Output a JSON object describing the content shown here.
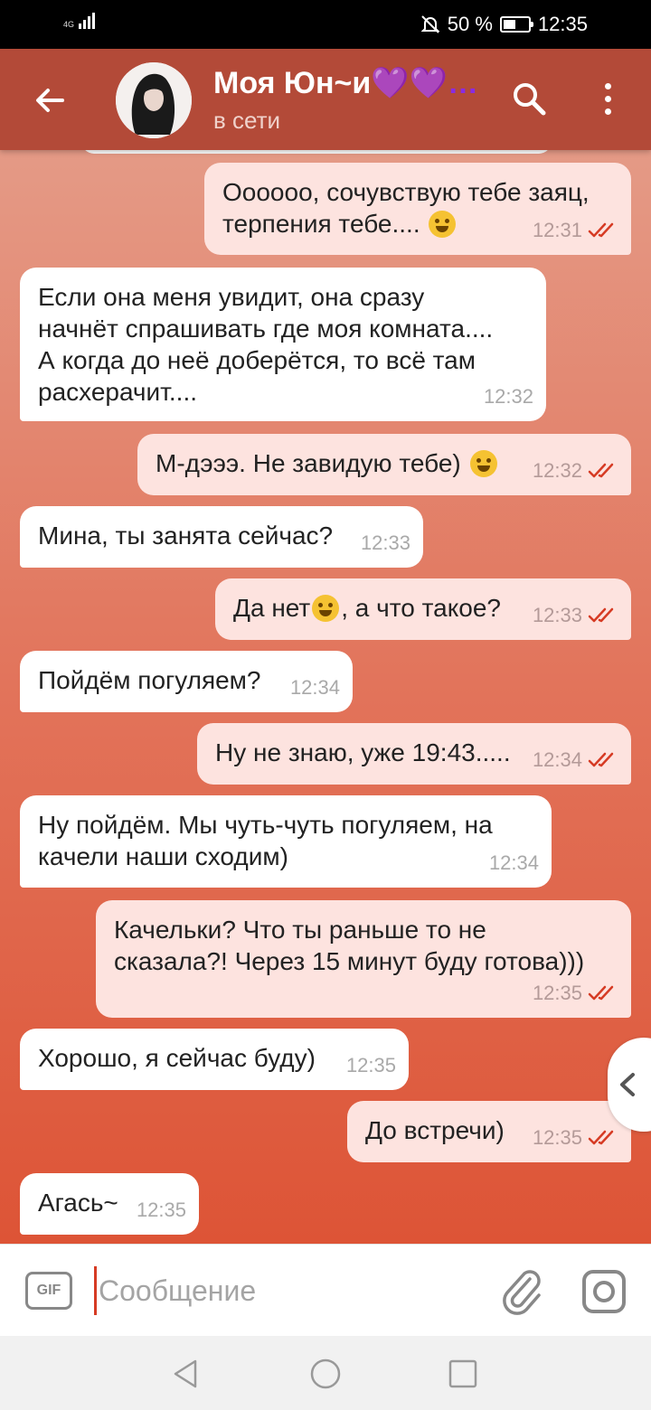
{
  "status_bar": {
    "network": "4G",
    "battery_text": "50 %",
    "battery_level": 0.5,
    "time": "12:35"
  },
  "header": {
    "contact_name": "Моя Юн~и",
    "name_suffix": "💜💜…",
    "contact_status": "в сети",
    "back_icon": "arrow-left-icon",
    "search_icon": "search-icon",
    "menu_icon": "more-vertical-icon"
  },
  "messages": [
    {
      "direction": "out",
      "text": "Oooooo, сочувствую тебе заяц,\nтерпения тебе....",
      "emoji": "grinning-sweat",
      "time": "12:31",
      "read": true
    },
    {
      "direction": "in",
      "text": "Если она меня увидит, она сразу\nначнёт спрашивать где моя комната....\nА когда до неё доберётся, то всё там\nрасхерачит....",
      "time": "12:32"
    },
    {
      "direction": "out",
      "text": "М-дэээ. Не завидую тебе)",
      "emoji": "squinting-laugh",
      "time": "12:32",
      "read": true
    },
    {
      "direction": "in",
      "text": "Мина, ты занята сейчас?",
      "time": "12:33"
    },
    {
      "direction": "out",
      "text_before": "Да нет",
      "emoji": "thinking",
      "text_after": ", а что такое?",
      "time": "12:33",
      "read": true
    },
    {
      "direction": "in",
      "text": "Пойдём погуляем?",
      "time": "12:34"
    },
    {
      "direction": "out",
      "text": "Ну не знаю, уже 19:43.....",
      "time": "12:34",
      "read": true
    },
    {
      "direction": "in",
      "text": "Ну пойдём. Мы чуть-чуть погуляем, на\nкачели наши сходим)",
      "time": "12:34"
    },
    {
      "direction": "out",
      "text": "Качельки? Что ты раньше то не\nсказала?! Через 15 минут буду готова)))",
      "time": "12:35",
      "read": true
    },
    {
      "direction": "in",
      "text": "Хорошо, я сейчас буду)",
      "time": "12:35"
    },
    {
      "direction": "out",
      "text": "До встречи)",
      "time": "12:35",
      "read": true
    },
    {
      "direction": "in",
      "text": "Агась~",
      "time": "12:35"
    }
  ],
  "input_bar": {
    "gif_label": "GIF",
    "placeholder": "Сообщение",
    "value": "",
    "attach_icon": "paperclip-icon",
    "camera_icon": "camera-icon"
  },
  "nav_bar": {
    "back_icon": "triangle-back-icon",
    "home_icon": "circle-home-icon",
    "recents_icon": "square-recents-icon"
  },
  "colors": {
    "header": "#b34a38",
    "incoming_bubble": "#ffffff",
    "outgoing_bubble": "#fde3df",
    "read_check": "#d63b24",
    "background_top": "#e49a86",
    "background_bottom": "#dd5436"
  }
}
